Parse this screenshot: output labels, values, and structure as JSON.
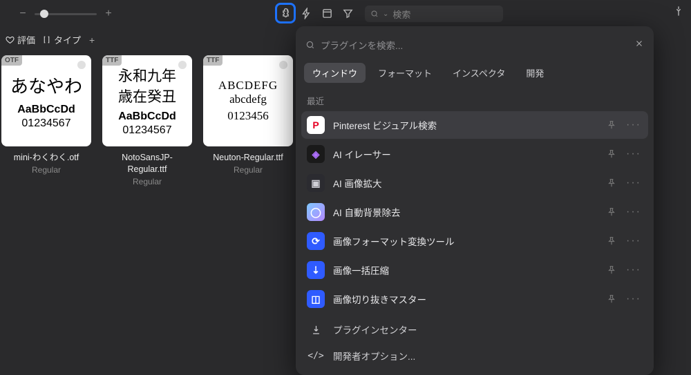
{
  "toolbar": {
    "search_placeholder": "検索"
  },
  "filters": {
    "rating_label": "評価",
    "type_label": "タイプ"
  },
  "thumbs": [
    {
      "badge": "OTF",
      "line1": "あなやわ",
      "line3": "AaBbCcDd",
      "line4": "01234567",
      "name": "mini-わくわく.otf",
      "sub": "Regular"
    },
    {
      "badge": "TTF",
      "line1": "永和九年",
      "line2": "歳在癸丑",
      "line3": "AaBbCcDd",
      "line4": "01234567",
      "name": "NotoSansJP-Regular.ttf",
      "sub": "Regular"
    },
    {
      "badge": "TTF",
      "line1": "ABCDEFG",
      "line2": "abcdefg",
      "line3": "0123456",
      "name": "Neuton-Regular.ttf",
      "sub": "Regular"
    }
  ],
  "panel": {
    "search_placeholder": "プラグインを検索...",
    "tabs": [
      "ウィンドウ",
      "フォーマット",
      "インスペクタ",
      "開発"
    ],
    "section_label": "最近",
    "plugins": [
      {
        "label": "Pinterest ビジュアル検索",
        "bg": "#ffffff",
        "fg": "#e60023",
        "glyph": "P"
      },
      {
        "label": "AI イレーサー",
        "bg": "#1a1a1a",
        "fg": "#b070ff",
        "glyph": "◈"
      },
      {
        "label": "AI 画像拡大",
        "bg": "#2b2b30",
        "fg": "#cfcfd6",
        "glyph": "▣"
      },
      {
        "label": "AI 自動背景除去",
        "bg": "linear-gradient(135deg,#7fc8ff,#b388ff)",
        "fg": "#fff",
        "glyph": "◯"
      },
      {
        "label": "画像フォーマット変換ツール",
        "bg": "#2f5bff",
        "fg": "#fff",
        "glyph": "⟳"
      },
      {
        "label": "画像一括圧縮",
        "bg": "#2f5bff",
        "fg": "#fff",
        "glyph": "⇣"
      },
      {
        "label": "画像切り抜きマスター",
        "bg": "#2f5bff",
        "fg": "#fff",
        "glyph": "◫"
      }
    ],
    "footer": {
      "plugin_center": "プラグインセンター",
      "dev_options": "開発者オプション..."
    }
  }
}
